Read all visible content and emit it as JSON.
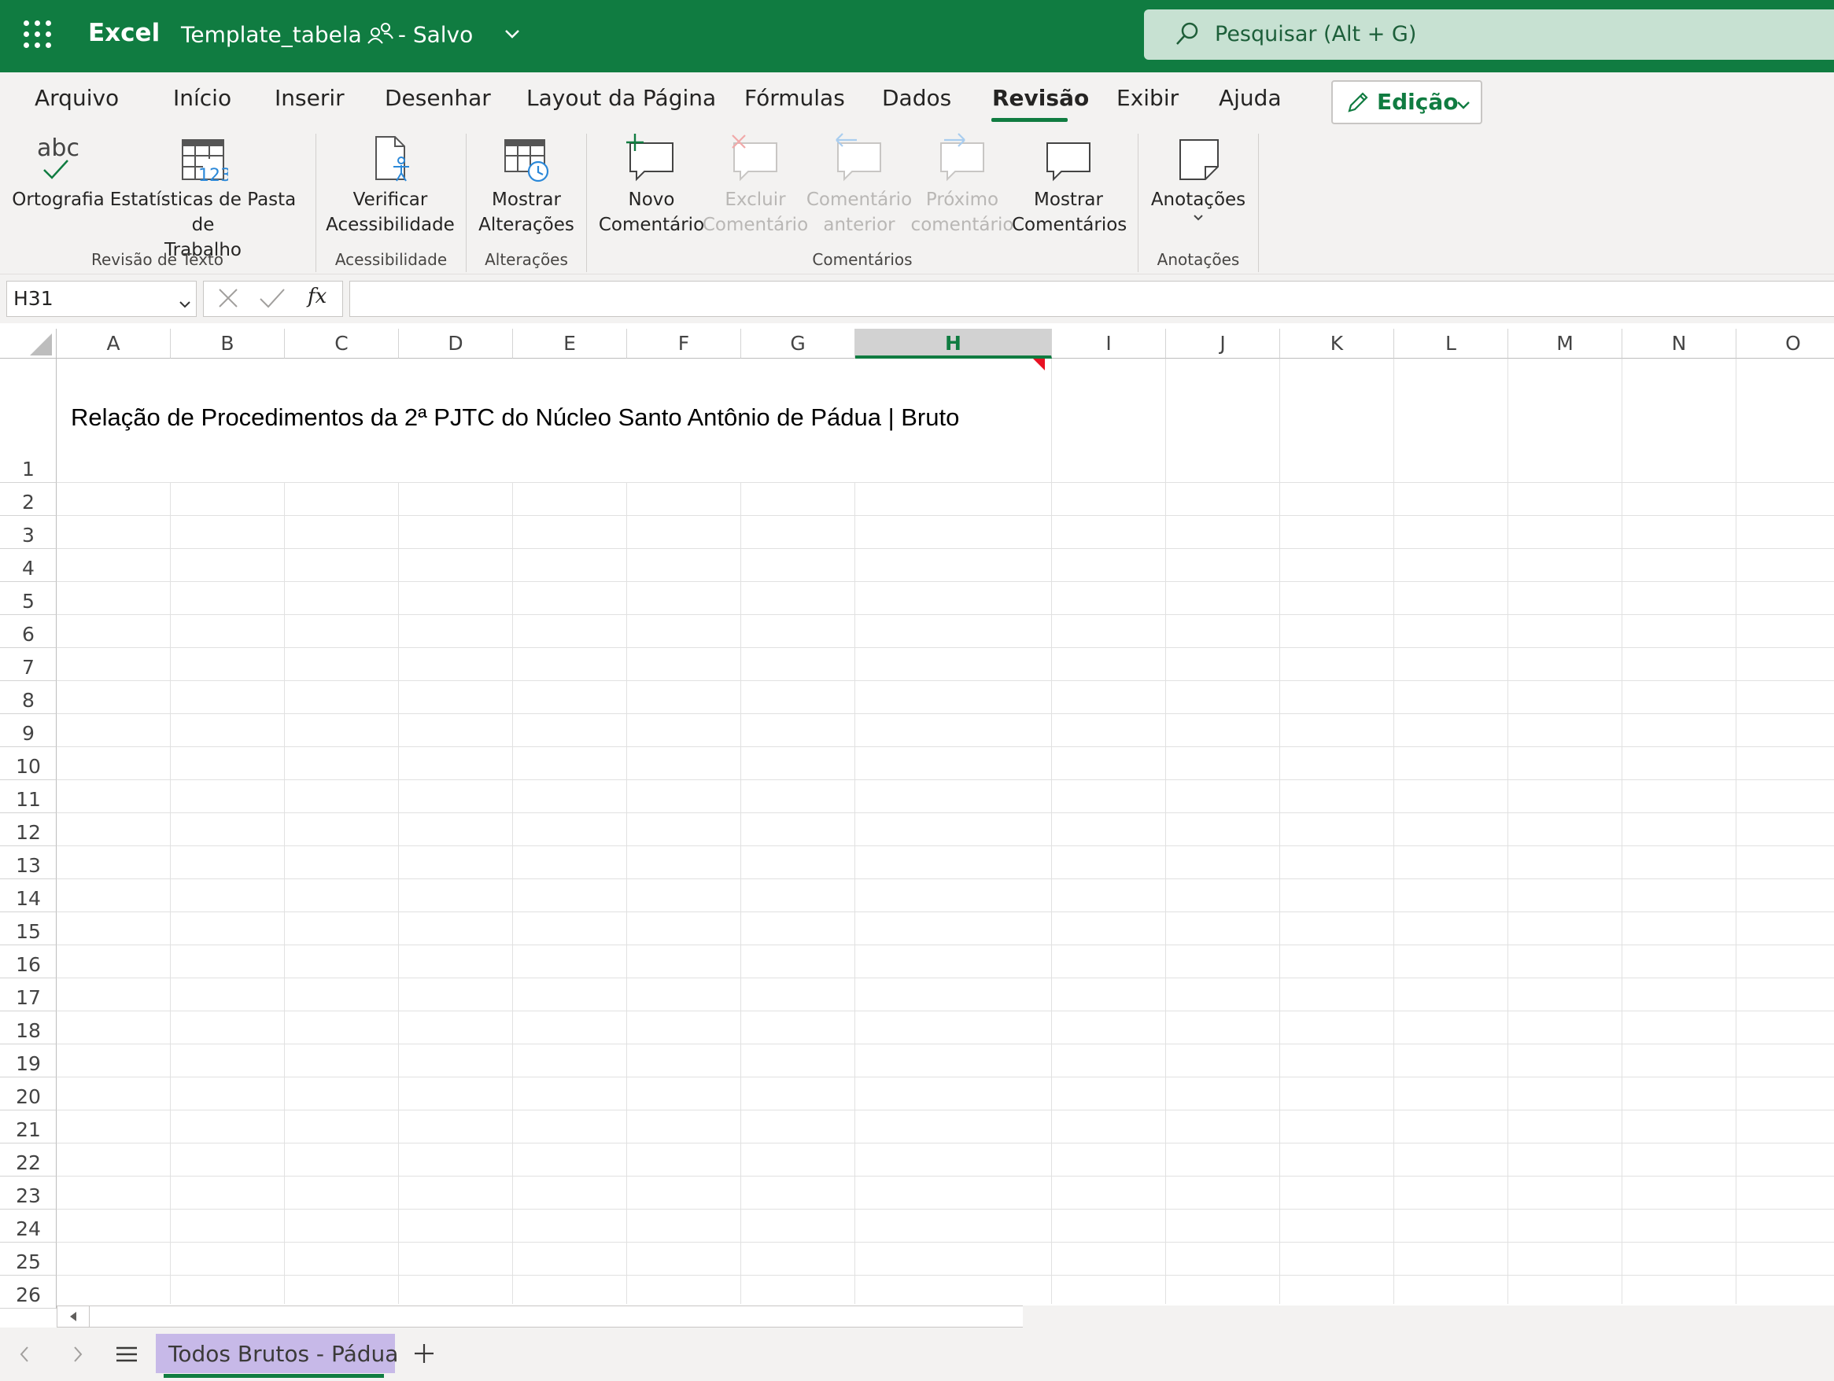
{
  "titlebar": {
    "app_name": "Excel",
    "doc_name": "Template_tabela",
    "save_status": "-  Salvo",
    "search_placeholder": "Pesquisar (Alt + G)"
  },
  "tabs": [
    {
      "label": "Arquivo"
    },
    {
      "label": "Início"
    },
    {
      "label": "Inserir"
    },
    {
      "label": "Desenhar"
    },
    {
      "label": "Layout da Página"
    },
    {
      "label": "Fórmulas"
    },
    {
      "label": "Dados"
    },
    {
      "label": "Revisão",
      "active": true
    },
    {
      "label": "Exibir"
    },
    {
      "label": "Ajuda"
    }
  ],
  "edit_mode": "Edição",
  "ribbon": {
    "spelling": "Ortografia",
    "workbook_stats_1": "Estatísticas de Pasta de",
    "workbook_stats_2": "Trabalho",
    "group_proofing": "Revisão de Texto",
    "check_access_1": "Verificar",
    "check_access_2": "Acessibilidade",
    "group_accessibility": "Acessibilidade",
    "show_changes_1": "Mostrar",
    "show_changes_2": "Alterações",
    "group_changes": "Alterações",
    "new_comment_1": "Novo",
    "new_comment_2": "Comentário",
    "delete_comment_1": "Excluir",
    "delete_comment_2": "Comentário",
    "prev_comment_1": "Comentário",
    "prev_comment_2": "anterior",
    "next_comment_1": "Próximo",
    "next_comment_2": "comentário",
    "show_comments_1": "Mostrar",
    "show_comments_2": "Comentários",
    "group_comments": "Comentários",
    "notes": "Anotações",
    "group_notes": "Anotações",
    "abc_icon_text": "abc",
    "stats_icon_text": "123"
  },
  "formula_bar": {
    "name_box": "H31",
    "fx": "fx",
    "formula": ""
  },
  "grid": {
    "columns": [
      "A",
      "B",
      "C",
      "D",
      "E",
      "F",
      "G",
      "H",
      "I",
      "J",
      "K",
      "L",
      "M",
      "N",
      "O"
    ],
    "selected_column": "H",
    "rows": [
      "1",
      "2",
      "3",
      "4",
      "5",
      "6",
      "7",
      "8",
      "9",
      "10",
      "11",
      "12",
      "13",
      "14",
      "15",
      "16",
      "17",
      "18",
      "19",
      "20",
      "21",
      "22",
      "23",
      "24",
      "25",
      "26"
    ],
    "title_text": "Relação de Procedimentos da 2ª PJTC do Núcleo Santo Antônio de Pádua |  Bruto"
  },
  "sheets": [
    {
      "label": "Todos Brutos - Pádua",
      "active": true
    }
  ],
  "colors": {
    "brand": "#107c41",
    "search_bg": "#c7e1d2",
    "sheet_tab": "#c7b9e8",
    "comment_flag": "#e81123"
  }
}
